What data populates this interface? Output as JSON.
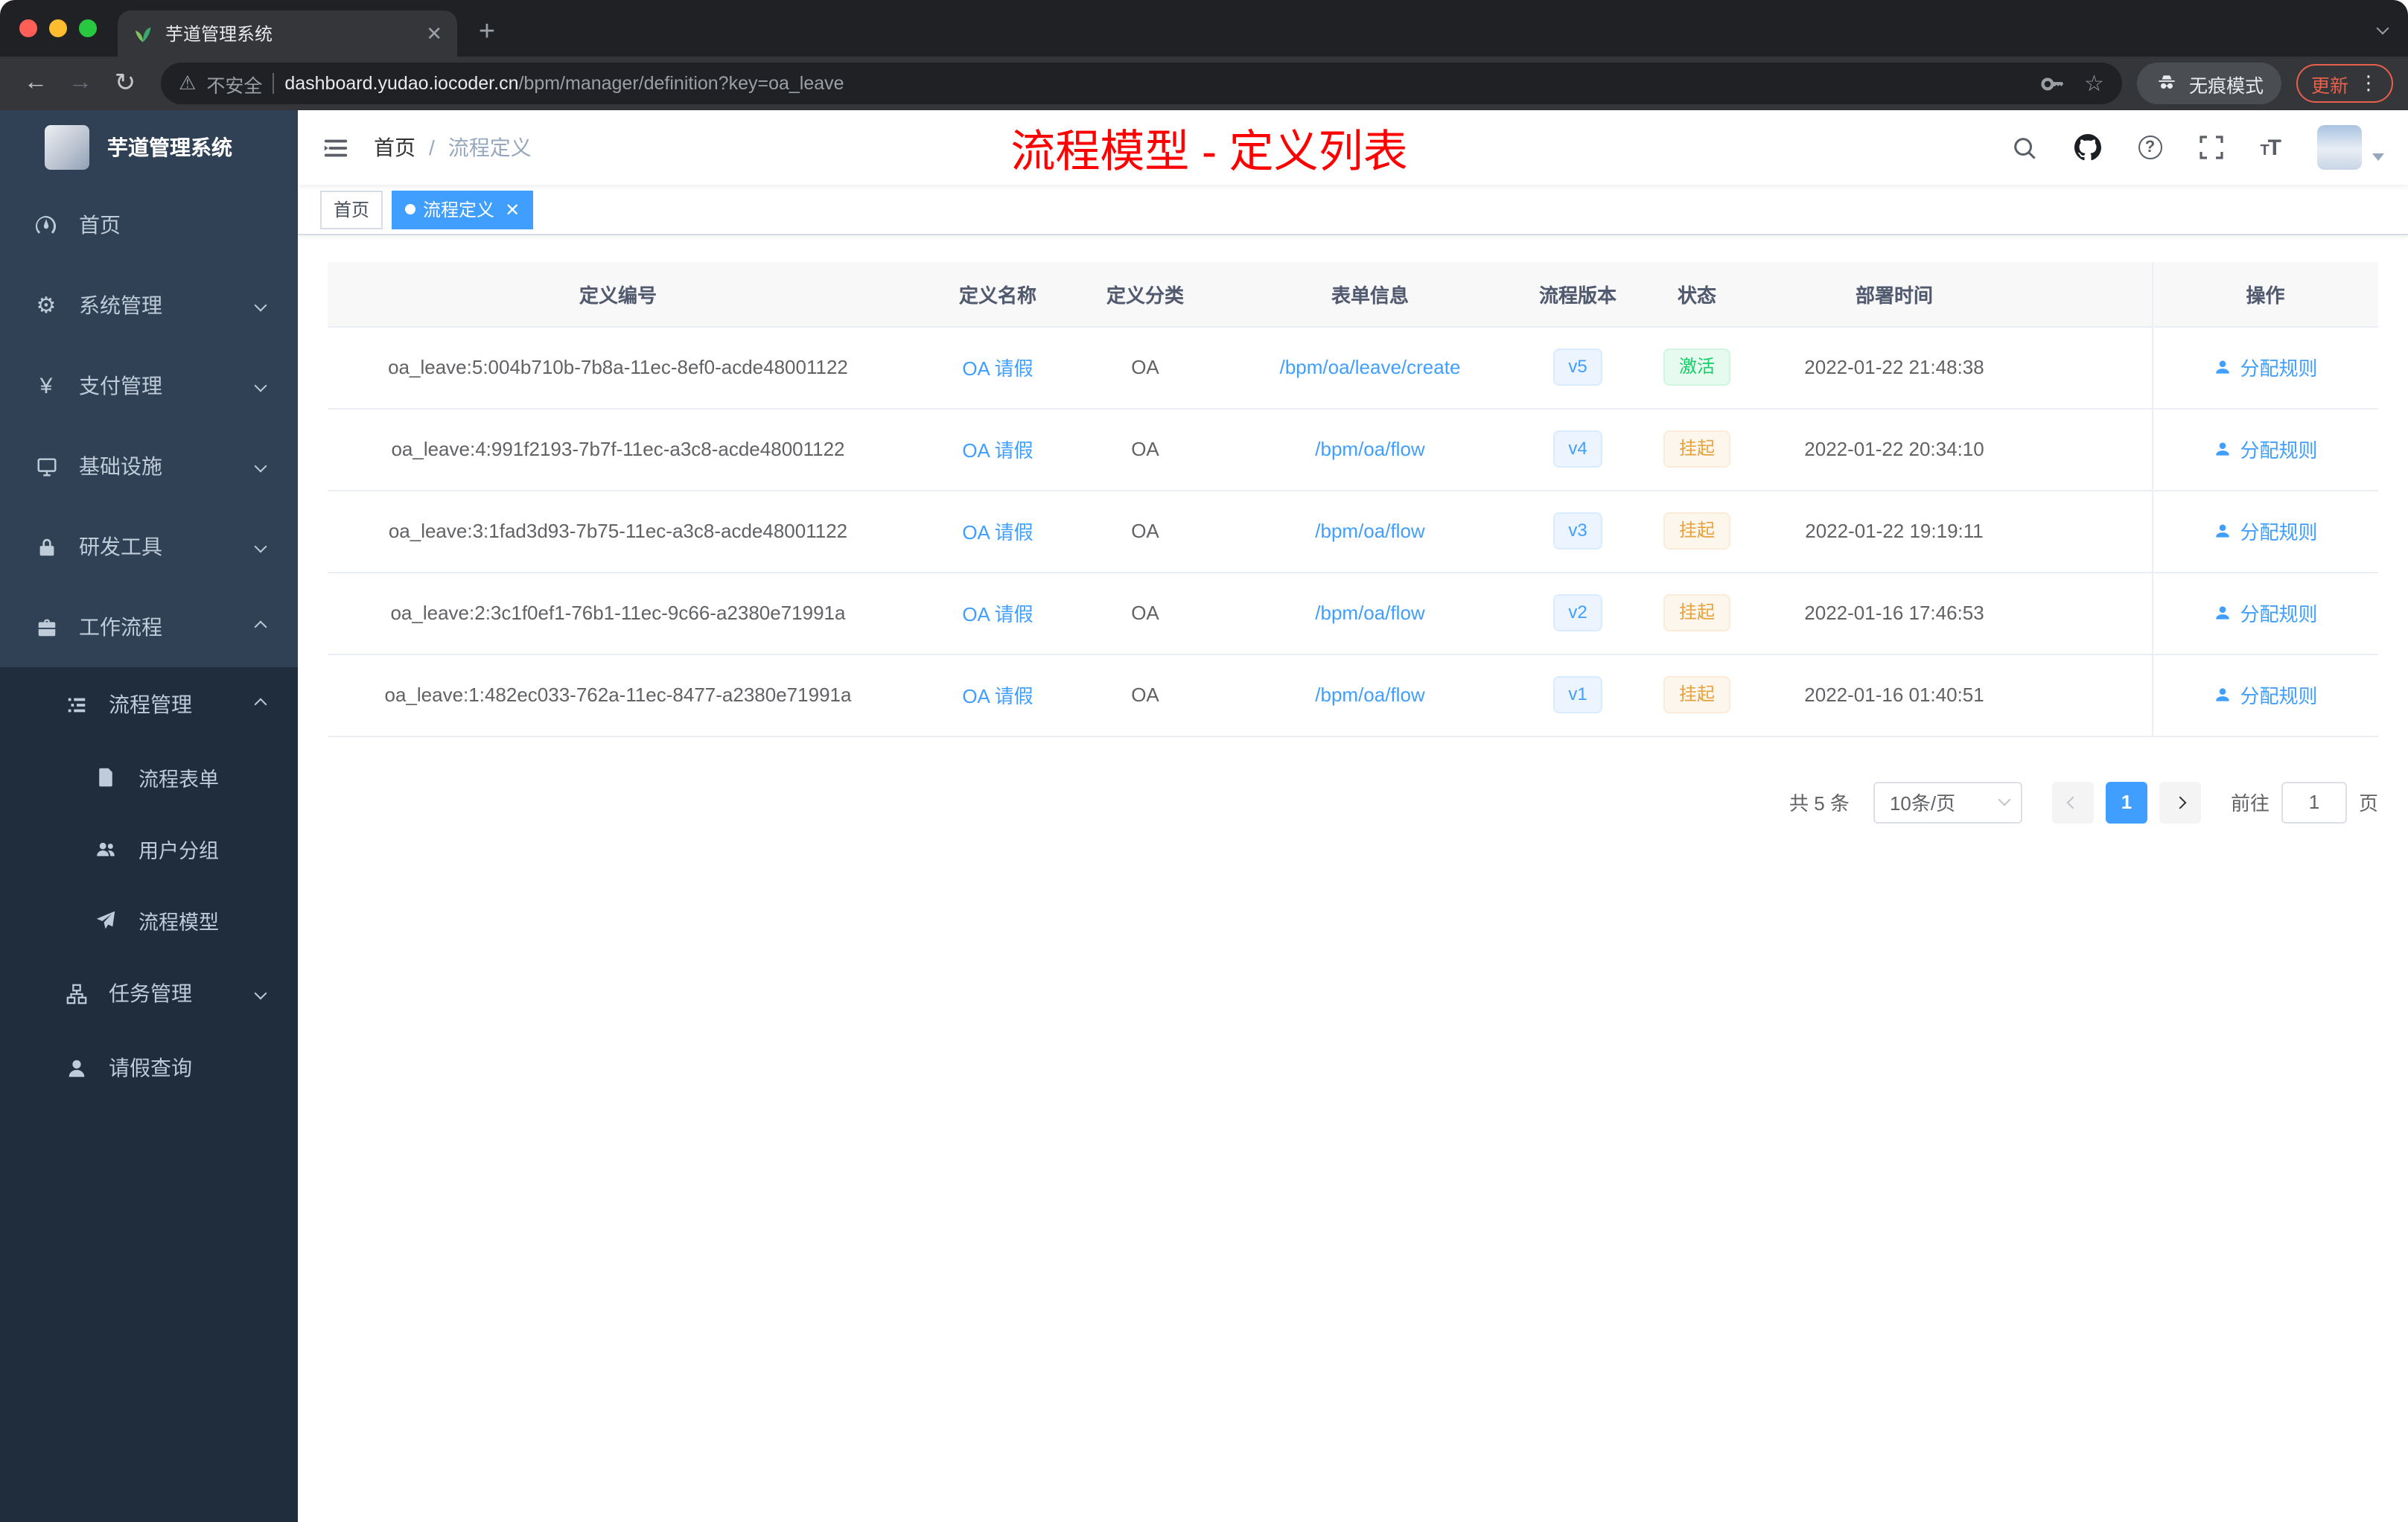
{
  "browser": {
    "tab_title": "芋道管理系统",
    "address": {
      "security_label": "不安全",
      "domain": "dashboard.yudao.iocoder.cn",
      "path": "/bpm/manager/definition?key=oa_leave"
    },
    "incognito_label": "无痕模式",
    "update_label": "更新"
  },
  "sidebar": {
    "brand": "芋道管理系统",
    "menu": [
      {
        "label": "首页"
      },
      {
        "label": "系统管理"
      },
      {
        "label": "支付管理"
      },
      {
        "label": "基础设施"
      },
      {
        "label": "研发工具"
      },
      {
        "label": "工作流程"
      },
      {
        "label": "流程管理"
      },
      {
        "label": "流程表单"
      },
      {
        "label": "用户分组"
      },
      {
        "label": "流程模型"
      },
      {
        "label": "任务管理"
      },
      {
        "label": "请假查询"
      }
    ]
  },
  "header": {
    "breadcrumb_home": "首页",
    "breadcrumb_current": "流程定义",
    "annotation": "流程模型 - 定义列表"
  },
  "tags_view": {
    "home": "首页",
    "active": "流程定义"
  },
  "table": {
    "columns": [
      "定义编号",
      "定义名称",
      "定义分类",
      "表单信息",
      "流程版本",
      "状态",
      "部署时间",
      "操作"
    ],
    "rows": [
      {
        "id": "oa_leave:5:004b710b-7b8a-11ec-8ef0-acde48001122",
        "name": "OA 请假",
        "category": "OA",
        "form": "/bpm/oa/leave/create",
        "version": "v5",
        "status": "激活",
        "status_type": "success",
        "deploy_time": "2022-01-22 21:48:38",
        "action": "分配规则"
      },
      {
        "id": "oa_leave:4:991f2193-7b7f-11ec-a3c8-acde48001122",
        "name": "OA 请假",
        "category": "OA",
        "form": "/bpm/oa/flow",
        "version": "v4",
        "status": "挂起",
        "status_type": "warning",
        "deploy_time": "2022-01-22 20:34:10",
        "action": "分配规则"
      },
      {
        "id": "oa_leave:3:1fad3d93-7b75-11ec-a3c8-acde48001122",
        "name": "OA 请假",
        "category": "OA",
        "form": "/bpm/oa/flow",
        "version": "v3",
        "status": "挂起",
        "status_type": "warning",
        "deploy_time": "2022-01-22 19:19:11",
        "action": "分配规则"
      },
      {
        "id": "oa_leave:2:3c1f0ef1-76b1-11ec-9c66-a2380e71991a",
        "name": "OA 请假",
        "category": "OA",
        "form": "/bpm/oa/flow",
        "version": "v2",
        "status": "挂起",
        "status_type": "warning",
        "deploy_time": "2022-01-16 17:46:53",
        "action": "分配规则"
      },
      {
        "id": "oa_leave:1:482ec033-762a-11ec-8477-a2380e71991a",
        "name": "OA 请假",
        "category": "OA",
        "form": "/bpm/oa/flow",
        "version": "v1",
        "status": "挂起",
        "status_type": "warning",
        "deploy_time": "2022-01-16 01:40:51",
        "action": "分配规则"
      }
    ]
  },
  "pagination": {
    "total": "共 5 条",
    "page_size": "10条/页",
    "current_page": "1",
    "goto_label": "前往",
    "goto_value": "1",
    "page_suffix": "页"
  },
  "icons": {
    "gear": "⚙",
    "yen": "¥",
    "warning": "⚠",
    "refresh": "↻",
    "back": "←",
    "forward": "→",
    "star": "☆",
    "more_dots": "⋮",
    "plus": "+",
    "close": "✕"
  },
  "colors": {
    "primary": "#409eff",
    "success": "#13ce66",
    "warning": "#e6a23c",
    "annotation": "#ff0000",
    "sidebar": "#304156",
    "sidebar_sub": "#1f2d3d"
  }
}
